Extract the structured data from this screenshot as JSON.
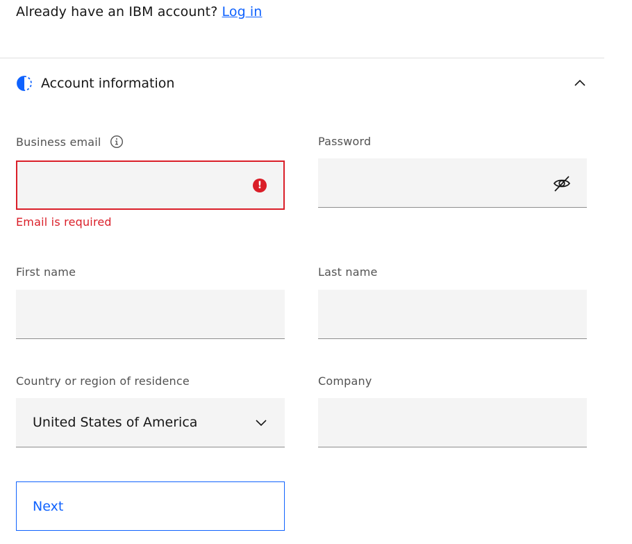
{
  "login_prompt": {
    "text": "Already have an IBM account?",
    "link_label": "Log in"
  },
  "section": {
    "title": "Account information",
    "icon": "half-circle-progress-icon",
    "expanded": true
  },
  "fields": {
    "email": {
      "label": "Business email",
      "value": "",
      "error": "Email is required",
      "info_icon": "info-icon",
      "error_icon": "!"
    },
    "password": {
      "label": "Password",
      "value": "",
      "toggle_icon": "eye-hidden-icon"
    },
    "first_name": {
      "label": "First name",
      "value": ""
    },
    "last_name": {
      "label": "Last name",
      "value": ""
    },
    "country": {
      "label": "Country or region of residence",
      "value": "United States of America"
    },
    "company": {
      "label": "Company",
      "value": ""
    }
  },
  "next_button": {
    "label": "Next"
  },
  "colors": {
    "primary": "#0f62fe",
    "error": "#da1e28",
    "field_bg": "#f4f4f4",
    "label": "#525252"
  }
}
